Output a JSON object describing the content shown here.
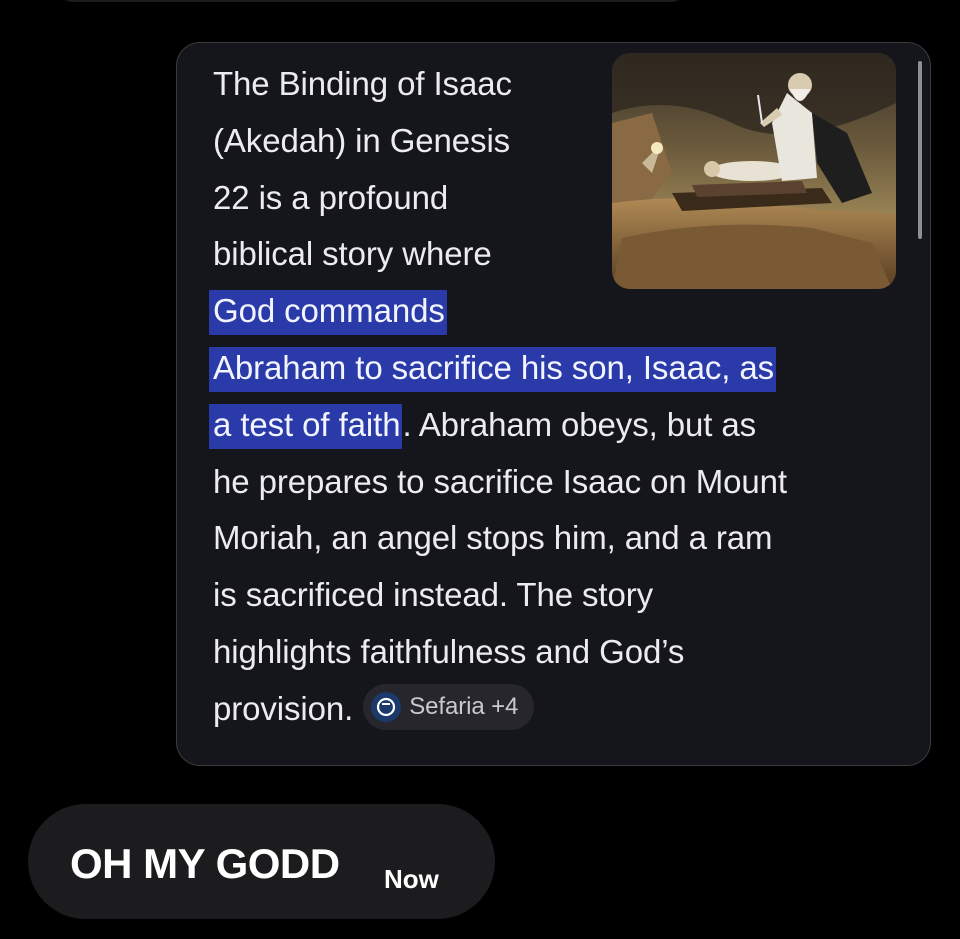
{
  "response_card": {
    "lines_top": [
      "The Binding of Isaac",
      "(Akedah) in Genesis",
      "22 is a profound",
      "biblical story where"
    ],
    "highlight_1": "God commands",
    "highlight_2": "Abraham to sacrifice his son, Isaac, as",
    "highlight_3": "a test of faith",
    "after_highlight": ". Abraham obeys, but as",
    "lines_bottom": [
      "he prepares to sacrifice Isaac on Mount",
      "Moriah, an angel stops him, and a ram",
      "is sacrificed instead. The story",
      "highlights faithfulness and God’s"
    ],
    "last_line": "provision.",
    "source_chip": {
      "label": "Sefaria +4",
      "icon": "sefaria-logo-icon"
    },
    "image_icon": "binding-of-isaac-painting-image"
  },
  "reply_message": {
    "text": "OH MY GODD",
    "timestamp": "Now"
  },
  "colors": {
    "background": "#000000",
    "card_background": "#15151c",
    "highlight": "#2a3aa8",
    "bubble": "#1c1c1e"
  }
}
